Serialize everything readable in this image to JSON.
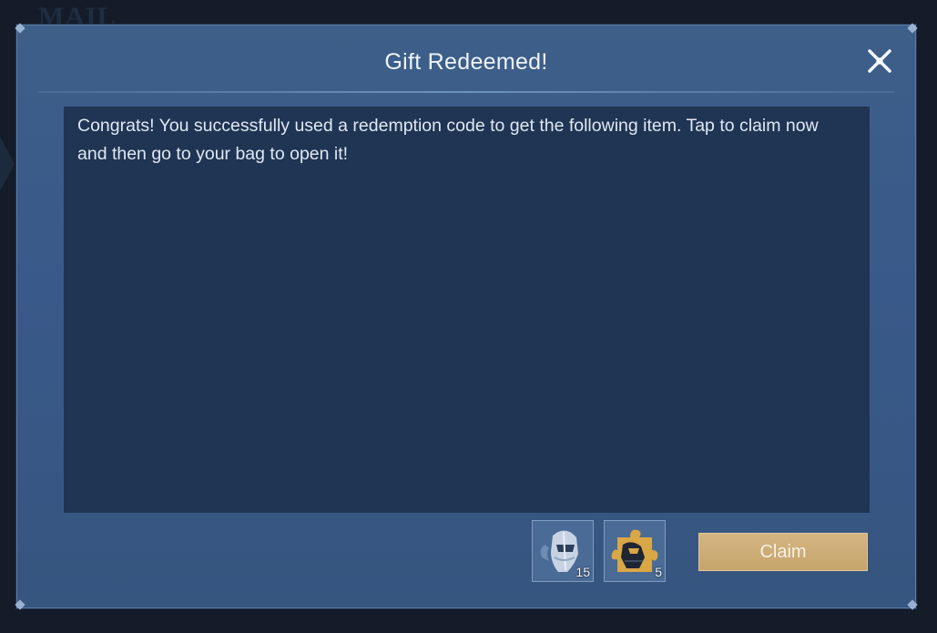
{
  "background": {
    "title": "MAIL"
  },
  "dialog": {
    "title": "Gift Redeemed!",
    "message": "Congrats! You successfully used a redemption code to get the following item. Tap to claim now and then go to your bag to open it!",
    "items": [
      {
        "icon": "helmet-fragment-icon",
        "count": "15"
      },
      {
        "icon": "puzzle-piece-icon",
        "count": "5"
      }
    ],
    "claim_label": "Claim"
  },
  "colors": {
    "dialog_bg": "#3b5c86",
    "panel_bg": "#203553",
    "claim_button": "#c9a871",
    "text": "#dfe8f4"
  }
}
